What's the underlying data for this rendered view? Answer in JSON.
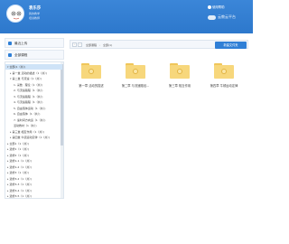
{
  "colors": {
    "header": "#2d78cc",
    "accent": "#2f7fd6",
    "folder": "#f7d77c"
  },
  "header": {
    "user_name": "袁乐莎",
    "line1": "我的教学",
    "line2": "培训教师",
    "help_label": "使用帮助",
    "brand": "云教云平台"
  },
  "sidebar": {
    "recent_label": "最近上传",
    "all_courses_label": "全部课程",
    "tree": [
      {
        "label": "全部(1（共）)",
        "indent": 1,
        "arrow": "▾",
        "selected": true
      },
      {
        "label": "第一章 活动的描述（1（共）)",
        "indent": 2,
        "arrow": "▸"
      },
      {
        "label": "第二章 与流速（1（共）)",
        "indent": 2,
        "arrow": "▾"
      },
      {
        "label": "1. 采数 · 理论（1（共）)",
        "indent": 3,
        "arrow": ""
      },
      {
        "label": "2. 与流速路程（1（共）)",
        "indent": 3,
        "arrow": ""
      },
      {
        "label": "3. 与流速路程（1（共）)",
        "indent": 3,
        "arrow": ""
      },
      {
        "label": "4. 与流速路程（1（共）)",
        "indent": 3,
        "arrow": ""
      },
      {
        "label": "5. 自由落体运动（1（共）)",
        "indent": 3,
        "arrow": ""
      },
      {
        "label": "6. 自由落体（1（共）)",
        "indent": 3,
        "arrow": ""
      },
      {
        "label": "7. 速时间方向运（1（共）)",
        "indent": 3,
        "arrow": ""
      },
      {
        "label": "活动教材（1（共）)",
        "indent": 3,
        "arrow": ""
      },
      {
        "label": "第三章 相互作用（1（共）)",
        "indent": 2,
        "arrow": "▸"
      },
      {
        "label": "第四章 牛顿运动定律（1（共）)",
        "indent": 2,
        "arrow": "▸"
      },
      {
        "label": "全部1（1（共）)",
        "indent": 1,
        "arrow": "▸"
      },
      {
        "label": "选修1（1（共）)",
        "indent": 1,
        "arrow": "▸"
      },
      {
        "label": "选修2（1（共）)",
        "indent": 1,
        "arrow": "▸"
      },
      {
        "label": "选修1-1（1（共）)",
        "indent": 1,
        "arrow": "▸"
      },
      {
        "label": "选修1-2（1（共）)",
        "indent": 1,
        "arrow": "▸"
      },
      {
        "label": "选修3（1（共）)",
        "indent": 1,
        "arrow": "▸"
      },
      {
        "label": "选修3-2（1（共）)",
        "indent": 1,
        "arrow": "▸"
      },
      {
        "label": "选修3-3（1（共）)",
        "indent": 1,
        "arrow": "▸"
      },
      {
        "label": "选修3-4（1（共）)",
        "indent": 1,
        "arrow": "▸"
      },
      {
        "label": "选修3-5（1（共）)",
        "indent": 1,
        "arrow": "▸"
      }
    ]
  },
  "toolbar": {
    "back_icon": "chevron-left-icon",
    "forward_icon": "chevron-right-icon",
    "crumbs": [
      "全部课程",
      "全部(1)"
    ],
    "new_folder_label": "新建文件夹"
  },
  "folders": [
    {
      "label": "第一章 活动的描述"
    },
    {
      "label": "第二章 与流速路径..."
    },
    {
      "label": "第三章 相互作用"
    },
    {
      "label": "第四章 牛顿运动定律"
    }
  ]
}
